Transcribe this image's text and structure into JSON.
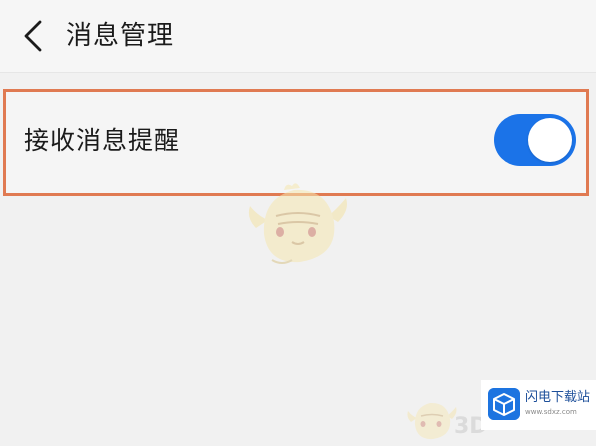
{
  "header": {
    "back_icon": "chevron-left-icon",
    "title": "消息管理"
  },
  "settings": [
    {
      "label": "接收消息提醒",
      "toggle_state": "on",
      "toggle_color": "#1b73e8"
    }
  ],
  "highlight_color": "#e07a52",
  "watermark": {
    "site_name": "闪电下载站",
    "site_url": "www.sdxz.com",
    "overlay_text": "3D"
  }
}
